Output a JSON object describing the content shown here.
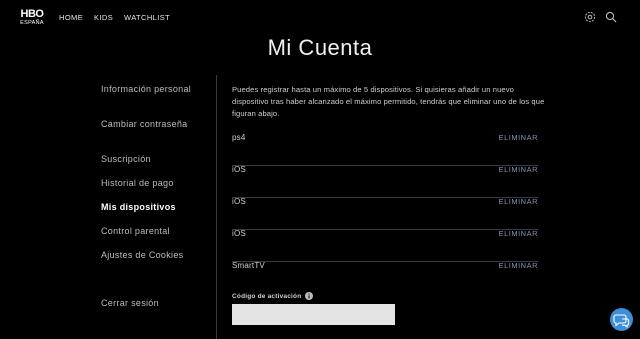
{
  "brand": {
    "logo": "HBO",
    "region": "ESPAÑA"
  },
  "nav": {
    "home": "HOME",
    "kids": "KIDS",
    "watchlist": "WATCHLIST",
    "settings_icon": "settings-icon",
    "search_icon": "search-icon"
  },
  "page": {
    "title": "Mi Cuenta"
  },
  "sidebar": {
    "items": [
      {
        "label": "Información personal",
        "active": false
      },
      {
        "label": "Cambiar contraseña",
        "active": false
      },
      {
        "label": "Suscripción",
        "active": false
      },
      {
        "label": "Historial de pago",
        "active": false
      },
      {
        "label": "Mis dispositivos",
        "active": true
      },
      {
        "label": "Control parental",
        "active": false
      },
      {
        "label": "Ajustes de Cookies",
        "active": false
      },
      {
        "label": "Cerrar sesión",
        "active": false
      }
    ]
  },
  "devices": {
    "intro": "Puedes registrar hasta un máximo de 5 dispositivos. Si quisieras añadir un nuevo dispositivo tras haber alcanzado el máximo permitido, tendrás que eliminar uno de los que figuran abajo.",
    "remove_label": "ELIMINAR",
    "list": [
      {
        "name": "ps4"
      },
      {
        "name": "iOS"
      },
      {
        "name": "iOS"
      },
      {
        "name": "iOS"
      },
      {
        "name": "SmartTV"
      }
    ]
  },
  "activation": {
    "label": "Código de activación",
    "value": "",
    "placeholder": ""
  },
  "colors": {
    "background": "#000000",
    "accent": "#7f93b4",
    "chat": "#3f8fd8",
    "input_bg": "#e4e4e4"
  }
}
